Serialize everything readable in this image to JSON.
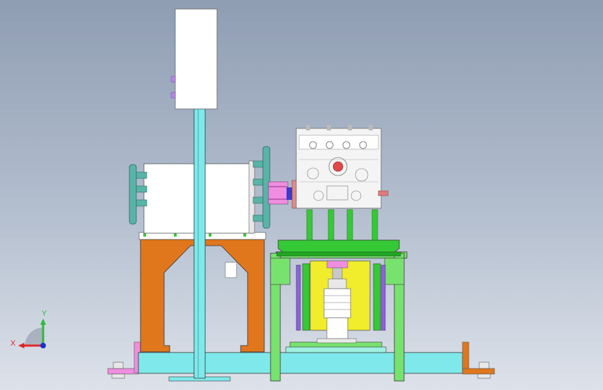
{
  "viewport": {
    "view": "front",
    "background": {
      "top": "#8f9db3",
      "bottom": "#dde2ea"
    }
  },
  "triad": {
    "x_label": "X",
    "y_label": "Y",
    "colors": {
      "x": "#e0252a",
      "y": "#2dbb3a",
      "z": "#1a2fd0"
    }
  },
  "palette": {
    "cyan": "#7fe8ea",
    "orange": "#e0771c",
    "green": "#78e26e",
    "dark_green": "#36c936",
    "yellow": "#f1ec2c",
    "purple": "#8c63d6",
    "pink": "#ef8ee0",
    "white": "#ffffff",
    "teal": "#59b3a7"
  }
}
